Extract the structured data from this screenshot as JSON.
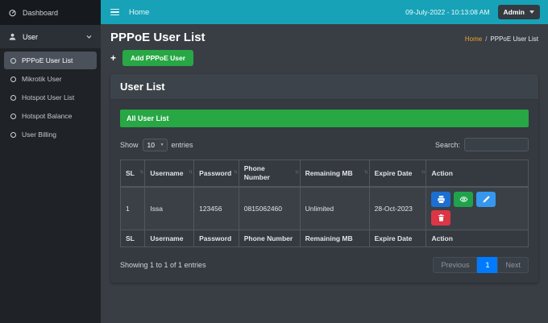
{
  "navbar": {
    "home": "Home",
    "datetime": "09-July-2022 - 10:13:08 AM",
    "admin": "Admin"
  },
  "sidebar": {
    "dashboard": "Dashboard",
    "user": "User",
    "subitems": [
      "PPPoE User List",
      "Mikrotik User",
      "Hotspot User List",
      "Hotspot Balance",
      "User Billing"
    ]
  },
  "page": {
    "title": "PPPoE User List",
    "breadcrumb": {
      "home": "Home",
      "separator": "/",
      "current": "PPPoE User List"
    },
    "plus": "+",
    "add_button": "Add PPPoE User"
  },
  "card": {
    "title": "User List",
    "banner": "All User List",
    "show_label": "Show",
    "entries_label": "entries",
    "page_length": "10",
    "search_label": "Search:",
    "search_value": "",
    "table": {
      "headers": [
        "SL",
        "Username",
        "Password",
        "Phone Number",
        "Remaining MB",
        "Expire Date",
        "Action"
      ],
      "rows": [
        {
          "sl": "1",
          "username": "Issa",
          "password": "123456",
          "phone": "0815062460",
          "remaining_mb": "Unlimited",
          "expire_date": "28-Oct-2023"
        }
      ],
      "footers": [
        "SL",
        "Username",
        "Password",
        "Phone Number",
        "Remaining MB",
        "Expire Date",
        "Action"
      ]
    },
    "info": "Showing 1 to 1 of 1 entries",
    "pagination": {
      "previous": "Previous",
      "current": "1",
      "next": "Next"
    }
  },
  "colors": {
    "navbar": "#17a2b8",
    "success_green": "#28a745",
    "primary_blue": "#007bff",
    "danger_red": "#dc3545",
    "breadcrumb_link": "#eda52c"
  }
}
